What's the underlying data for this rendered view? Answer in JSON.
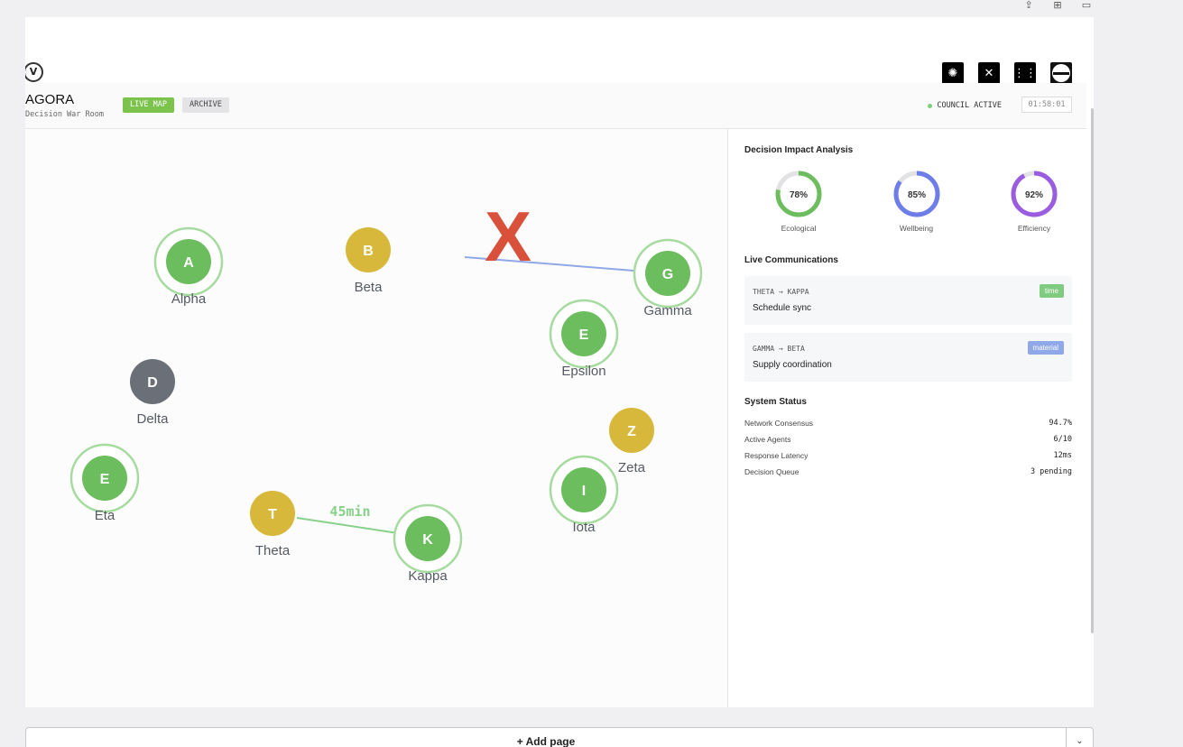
{
  "toolbar": {
    "icons": [
      "upload-icon",
      "add-frame-icon",
      "page-icon"
    ],
    "glyphs": [
      "⇪",
      "⊞",
      "▭"
    ]
  },
  "frame": {
    "logo_glyph": "V",
    "thumbnails": [
      "sun-thumb",
      "bandage-thumb",
      "grid-thumb",
      "globe-thumb"
    ],
    "thumb_glyphs": [
      "✺",
      "✕",
      "⋮⋮",
      ""
    ]
  },
  "header": {
    "app_name": "AGORA",
    "subtitle": "Decision War Room",
    "tabs": [
      {
        "label": "LIVE MAP",
        "active": true
      },
      {
        "label": "ARCHIVE",
        "active": false
      }
    ],
    "council_status": "COUNCIL ACTIVE",
    "timer": "01:58:01"
  },
  "map": {
    "colors": {
      "green": "#6bbd5e",
      "yellow": "#d7b83a",
      "gray": "#6b6f78",
      "ring": "#a6dba0",
      "blue": "#8fa8e8",
      "red": "#d9513a",
      "time": "#88d18a"
    },
    "nodes": [
      {
        "id": "alpha",
        "letter": "A",
        "label": "Alpha",
        "color": "green",
        "ring": true
      },
      {
        "id": "beta",
        "letter": "B",
        "label": "Beta",
        "color": "yellow",
        "ring": false
      },
      {
        "id": "gamma",
        "letter": "G",
        "label": "Gamma",
        "color": "green",
        "ring": true
      },
      {
        "id": "epsilon",
        "letter": "E",
        "label": "Epsilon",
        "color": "green",
        "ring": true
      },
      {
        "id": "delta",
        "letter": "D",
        "label": "Delta",
        "color": "gray",
        "ring": false
      },
      {
        "id": "zeta",
        "letter": "Z",
        "label": "Zeta",
        "color": "yellow",
        "ring": false
      },
      {
        "id": "eta",
        "letter": "E",
        "label": "Eta",
        "color": "green",
        "ring": true
      },
      {
        "id": "iota",
        "letter": "I",
        "label": "Iota",
        "color": "green",
        "ring": true
      },
      {
        "id": "theta",
        "letter": "T",
        "label": "Theta",
        "color": "yellow",
        "ring": false
      },
      {
        "id": "kappa",
        "letter": "K",
        "label": "Kappa",
        "color": "green",
        "ring": true
      }
    ],
    "blocked_mark": "X",
    "link_label": "45min"
  },
  "panel": {
    "impact_title": "Decision Impact Analysis",
    "gauges": [
      {
        "label": "Ecological",
        "value": 78,
        "text": "78%",
        "color": "#6bbd5e"
      },
      {
        "label": "Wellbeing",
        "value": 85,
        "text": "85%",
        "color": "#6d7ee8"
      },
      {
        "label": "Efficiency",
        "value": 92,
        "text": "92%",
        "color": "#9b5de0"
      }
    ],
    "comms_title": "Live Communications",
    "comms": [
      {
        "route": "THETA → KAPPA",
        "message": "Schedule sync",
        "tag": "time",
        "tag_color": "#7fcb7f"
      },
      {
        "route": "GAMMA → BETA",
        "message": "Supply coordination",
        "tag": "material",
        "tag_color": "#8fa8e8"
      }
    ],
    "status_title": "System Status",
    "status_rows": [
      {
        "key": "Network Consensus",
        "value": "94.7%"
      },
      {
        "key": "Active Agents",
        "value": "6/10"
      },
      {
        "key": "Response Latency",
        "value": "12ms"
      },
      {
        "key": "Decision Queue",
        "value": "3 pending"
      }
    ]
  },
  "add_page": {
    "label": "+ Add page",
    "chevron": "⌄"
  }
}
